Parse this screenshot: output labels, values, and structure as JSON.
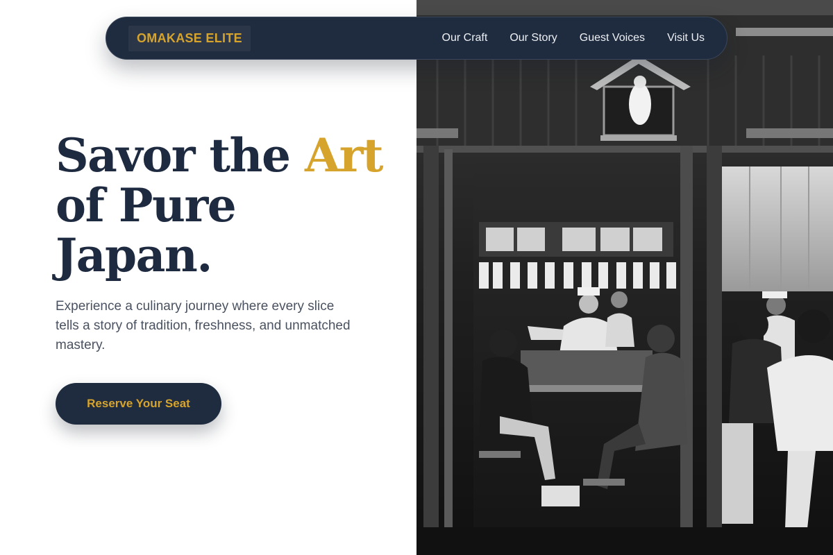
{
  "nav": {
    "brand": "OMAKASE ELITE",
    "links": [
      "Our Craft",
      "Our Story",
      "Guest Voices",
      "Visit Us"
    ]
  },
  "hero": {
    "title_part1": "Savor the",
    "title_accent": "Art",
    "title_line2": "of Pure",
    "title_line3": "Japan.",
    "subtitle": "Experience a culinary journey where every slice tells a story of tradition, freshness, and unmatched mastery.",
    "cta_label": "Reserve Your Seat"
  },
  "colors": {
    "navy": "#1f2b3f",
    "gold": "#d6a42c",
    "text_gray": "#4a5261"
  }
}
